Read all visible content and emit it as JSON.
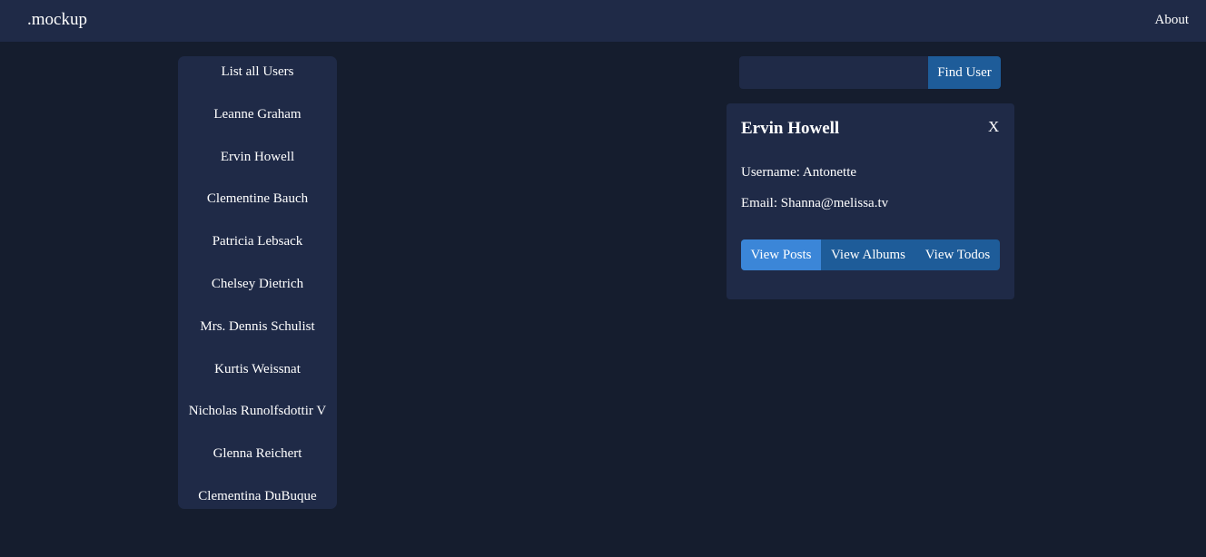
{
  "navbar": {
    "brand": ".mockup",
    "about_label": "About"
  },
  "userlist": {
    "heading": "List all Users",
    "users": [
      "Leanne Graham",
      "Ervin Howell",
      "Clementine Bauch",
      "Patricia Lebsack",
      "Chelsey Dietrich",
      "Mrs. Dennis Schulist",
      "Kurtis Weissnat",
      "Nicholas Runolfsdottir V",
      "Glenna Reichert",
      "Clementina DuBuque"
    ]
  },
  "search": {
    "value": "",
    "placeholder": "",
    "button_label": "Find User"
  },
  "user_card": {
    "name": "Ervin Howell",
    "close_label": "X",
    "username_line": "Username: Antonette",
    "email_line": "Email: Shanna@melissa.tv",
    "actions": [
      {
        "label": "View Posts",
        "active": true
      },
      {
        "label": "View Albums",
        "active": false
      },
      {
        "label": "View Todos",
        "active": false
      }
    ]
  },
  "colors": {
    "background": "#151d2e",
    "panel": "#1f2a47",
    "button": "#1e5c99",
    "button_active": "#3b86d8",
    "text": "#ffffff"
  }
}
